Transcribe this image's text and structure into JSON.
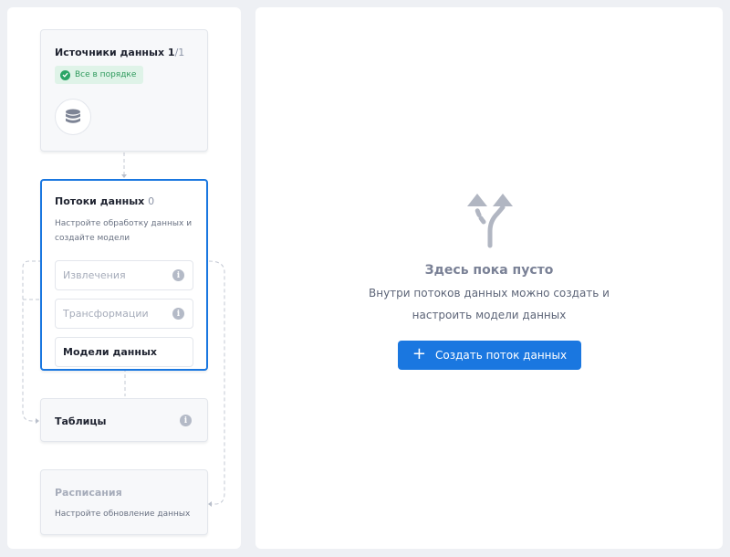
{
  "pipeline": {
    "sources": {
      "title": "Источники данных",
      "count_current": "1",
      "count_total": "/1",
      "status": "Все в порядке",
      "icon": "database-icon"
    },
    "flows": {
      "title": "Потоки данных",
      "count": "0",
      "description_line1": "Настройте обработку данных и",
      "description_line2": "создайте модели",
      "items": [
        {
          "label": "Извлечения",
          "icon": "info-icon"
        },
        {
          "label": "Трансформации",
          "icon": "info-icon"
        },
        {
          "label": "Модели данных"
        }
      ]
    },
    "tables": {
      "title": "Таблицы",
      "icon": "info-icon"
    },
    "schedules": {
      "title": "Расписания",
      "description": "Настройте обновление данных"
    }
  },
  "empty_state": {
    "icon": "branch-arrows-icon",
    "title": "Здесь пока пусто",
    "description_line1": "Внутри потоков данных можно создать и",
    "description_line2": "настроить модели данных",
    "button_label": "Создать поток данных",
    "button_icon": "plus-icon"
  },
  "colors": {
    "accent": "#1a77e0",
    "success": "#2aa566",
    "success_bg": "#dff3e8",
    "background": "#eef0f4"
  }
}
